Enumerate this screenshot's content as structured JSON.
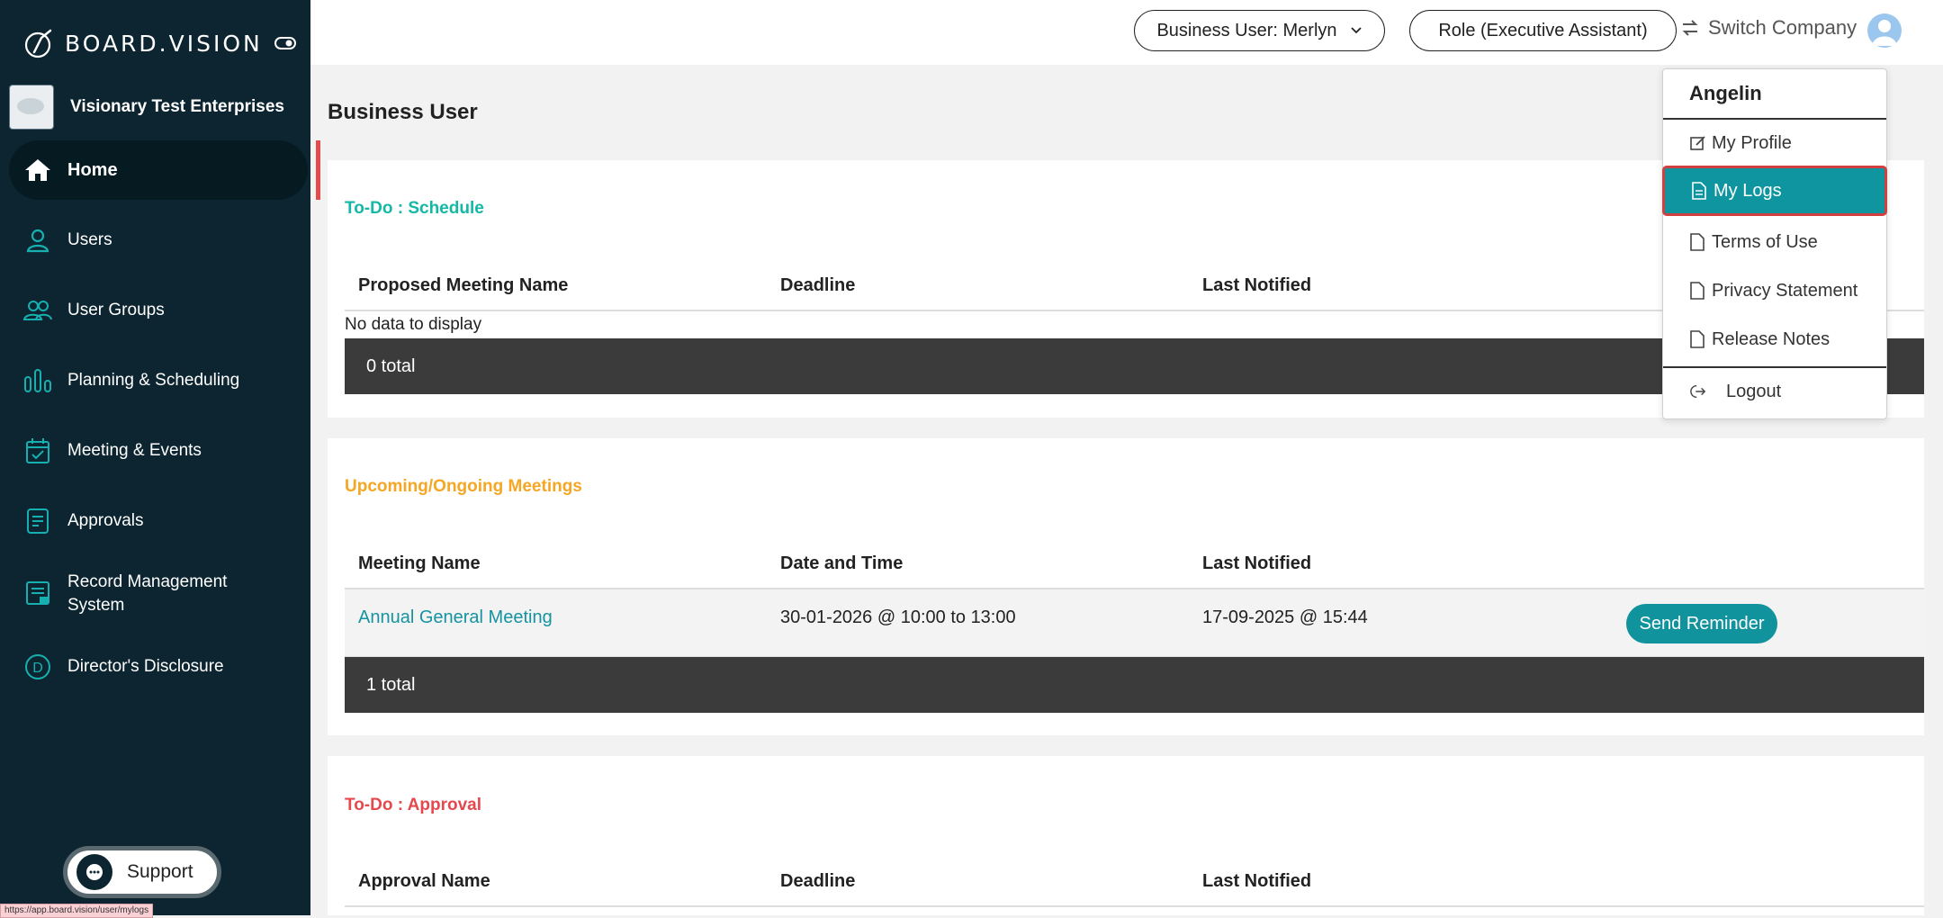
{
  "app": {
    "logo_text": "BOARD.VISION",
    "company_name": "Visionary Test Enterprises"
  },
  "sidebar": {
    "items": [
      {
        "label": "Home",
        "icon": "home-icon",
        "active": true
      },
      {
        "label": "Users",
        "icon": "user-icon"
      },
      {
        "label": "User Groups",
        "icon": "user-group-icon"
      },
      {
        "label": "Planning & Scheduling",
        "icon": "bar-chart-icon"
      },
      {
        "label": "Meeting & Events",
        "icon": "calendar-icon"
      },
      {
        "label": "Approvals",
        "icon": "document-icon"
      },
      {
        "label": "Record Management System",
        "icon": "record-icon"
      },
      {
        "label": "Director's Disclosure",
        "icon": "disclosure-icon"
      }
    ],
    "support_label": "Support",
    "status_url": "https://app.board.vision/user/mylogs"
  },
  "header": {
    "business_user": "Business User: Merlyn",
    "role": "Role (Executive Assistant)",
    "switch_company": "Switch Company"
  },
  "main": {
    "page_title": "Business User",
    "todo_schedule": {
      "heading": "To-Do : Schedule",
      "heading_color": "#14b8a6",
      "columns": [
        "Proposed Meeting Name",
        "Deadline",
        "Last Notified"
      ],
      "empty_text": "No data to display",
      "total": "0 total"
    },
    "meetings": {
      "heading": "Upcoming/Ongoing Meetings",
      "heading_color": "#f5a623",
      "columns": [
        "Meeting Name",
        "Date and Time",
        "Last Notified"
      ],
      "rows": [
        {
          "name": "Annual General Meeting",
          "datetime": "30-01-2026 @ 10:00 to 13:00",
          "last_notified": "17-09-2025 @ 15:44",
          "action": "Send Reminder"
        }
      ],
      "total": "1 total"
    },
    "todo_approval": {
      "heading": "To-Do : Approval",
      "heading_color": "#e5484d",
      "columns": [
        "Approval Name",
        "Deadline",
        "Last Notified"
      ]
    }
  },
  "user_menu": {
    "name": "Angelin",
    "items": [
      {
        "label": "My Profile",
        "icon": "edit-icon"
      },
      {
        "label": "My Logs",
        "icon": "file-text-icon",
        "selected": true
      },
      {
        "label": "Terms of Use",
        "icon": "file-icon"
      },
      {
        "label": "Privacy Statement",
        "icon": "file-icon"
      },
      {
        "label": "Release Notes",
        "icon": "file-icon"
      },
      {
        "label": "Logout",
        "icon": "logout-icon"
      }
    ]
  }
}
